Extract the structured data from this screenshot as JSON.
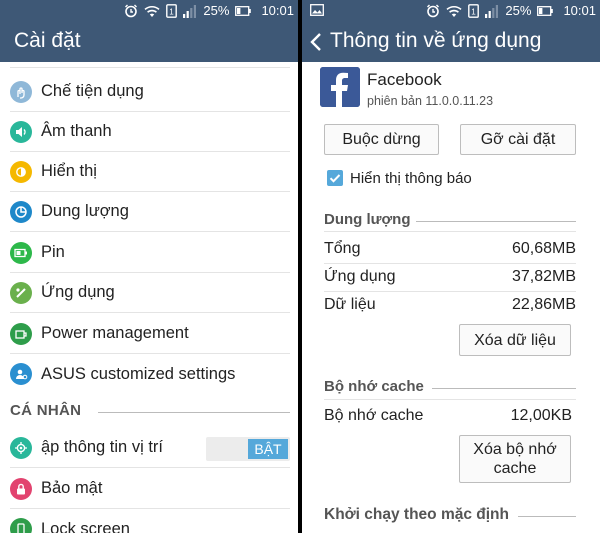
{
  "status_bar": {
    "battery": "25%",
    "time": "10:01",
    "sim_slot": "1"
  },
  "left": {
    "title": "Cài đặt",
    "items": [
      {
        "label": "Chế tiện dụng",
        "icon": "hand-icon",
        "color": "#8fb8d8"
      },
      {
        "label": "Âm thanh",
        "icon": "speaker-icon",
        "color": "#29b79a"
      },
      {
        "label": "Hiển thị",
        "icon": "brightness-icon",
        "color": "#f5b800"
      },
      {
        "label": "Dung lượng",
        "icon": "storage-icon",
        "color": "#1e88c9"
      },
      {
        "label": "Pin",
        "icon": "battery-icon",
        "color": "#2db84a"
      },
      {
        "label": "Ứng dụng",
        "icon": "android-icon",
        "color": "#6ab04c"
      },
      {
        "label": "Power management",
        "icon": "power-management-icon",
        "color": "#2e9d4a"
      },
      {
        "label": "ASUS customized settings",
        "icon": "asus-settings-icon",
        "color": "#2a8fd0"
      }
    ],
    "section_personal": "CÁ NHÂN",
    "personal_items": [
      {
        "label": "ập thông tin vị trí",
        "icon": "location-icon",
        "color": "#29b79a"
      },
      {
        "label": "Bảo mật",
        "icon": "lock-icon",
        "color": "#e2436f"
      },
      {
        "label": "Lock screen",
        "icon": "lock-screen-icon",
        "color": "#2e9d4a"
      }
    ],
    "toggle_on": "BẬT"
  },
  "right": {
    "title": "Thông tin về ứng dụng",
    "app_name": "Facebook",
    "version": "phiên bản 11.0.0.11.23",
    "force_stop": "Buộc dừng",
    "uninstall": "Gỡ cài đặt",
    "show_notifications": "Hiển thị thông báo",
    "storage_header": "Dung lượng",
    "storage_rows": [
      {
        "key": "Tổng",
        "value": "60,68MB"
      },
      {
        "key": "Ứng dụng",
        "value": "37,82MB"
      },
      {
        "key": "Dữ liệu",
        "value": "22,86MB"
      }
    ],
    "clear_data": "Xóa dữ liệu",
    "cache_header": "Bộ nhớ cache",
    "cache_row": {
      "key": "Bộ nhớ cache",
      "value": "12,00KB"
    },
    "clear_cache": "Xóa bộ nhớ cache",
    "launch_header": "Khởi chạy theo mặc định"
  },
  "colors": {
    "app_bar": "#3e5876",
    "accent": "#55a8da",
    "facebook": "#3b5998"
  }
}
